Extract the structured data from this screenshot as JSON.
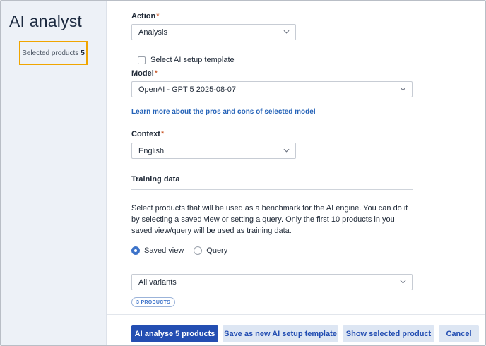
{
  "sidebar": {
    "app_title": "AI analyst",
    "selected_products_label": "Selected products",
    "selected_products_count": "5"
  },
  "form": {
    "action": {
      "label": "Action",
      "required_mark": "*",
      "value": "Analysis"
    },
    "setup_template": {
      "label": "Select AI setup template",
      "checked": false
    },
    "model": {
      "label": "Model",
      "required_mark": "*",
      "value": "OpenAI - GPT 5 2025-08-07"
    },
    "model_link": "Learn more about the pros and cons of selected model",
    "context": {
      "label": "Context",
      "required_mark": "*",
      "value": "English"
    },
    "training": {
      "title": "Training data",
      "description": "Select products that will be used as a benchmark for the AI engine. You can do it by selecting a saved view or setting a query. Only the first 10 products in you saved view/query will be used as training data.",
      "radio_saved_view": "Saved view",
      "radio_query": "Query",
      "selected_radio": "Saved view",
      "variants_value": "All variants",
      "products_badge": "3 PRODUCTS"
    }
  },
  "footer": {
    "analyse_button": "AI analyse 5 products",
    "save_template_button": "Save as new AI setup template",
    "show_selected_button": "Show selected product",
    "cancel_button": "Cancel"
  },
  "colors": {
    "accent": "#234eb2",
    "highlight_border": "#f0a500",
    "sidebar_bg": "#edf1f7"
  }
}
